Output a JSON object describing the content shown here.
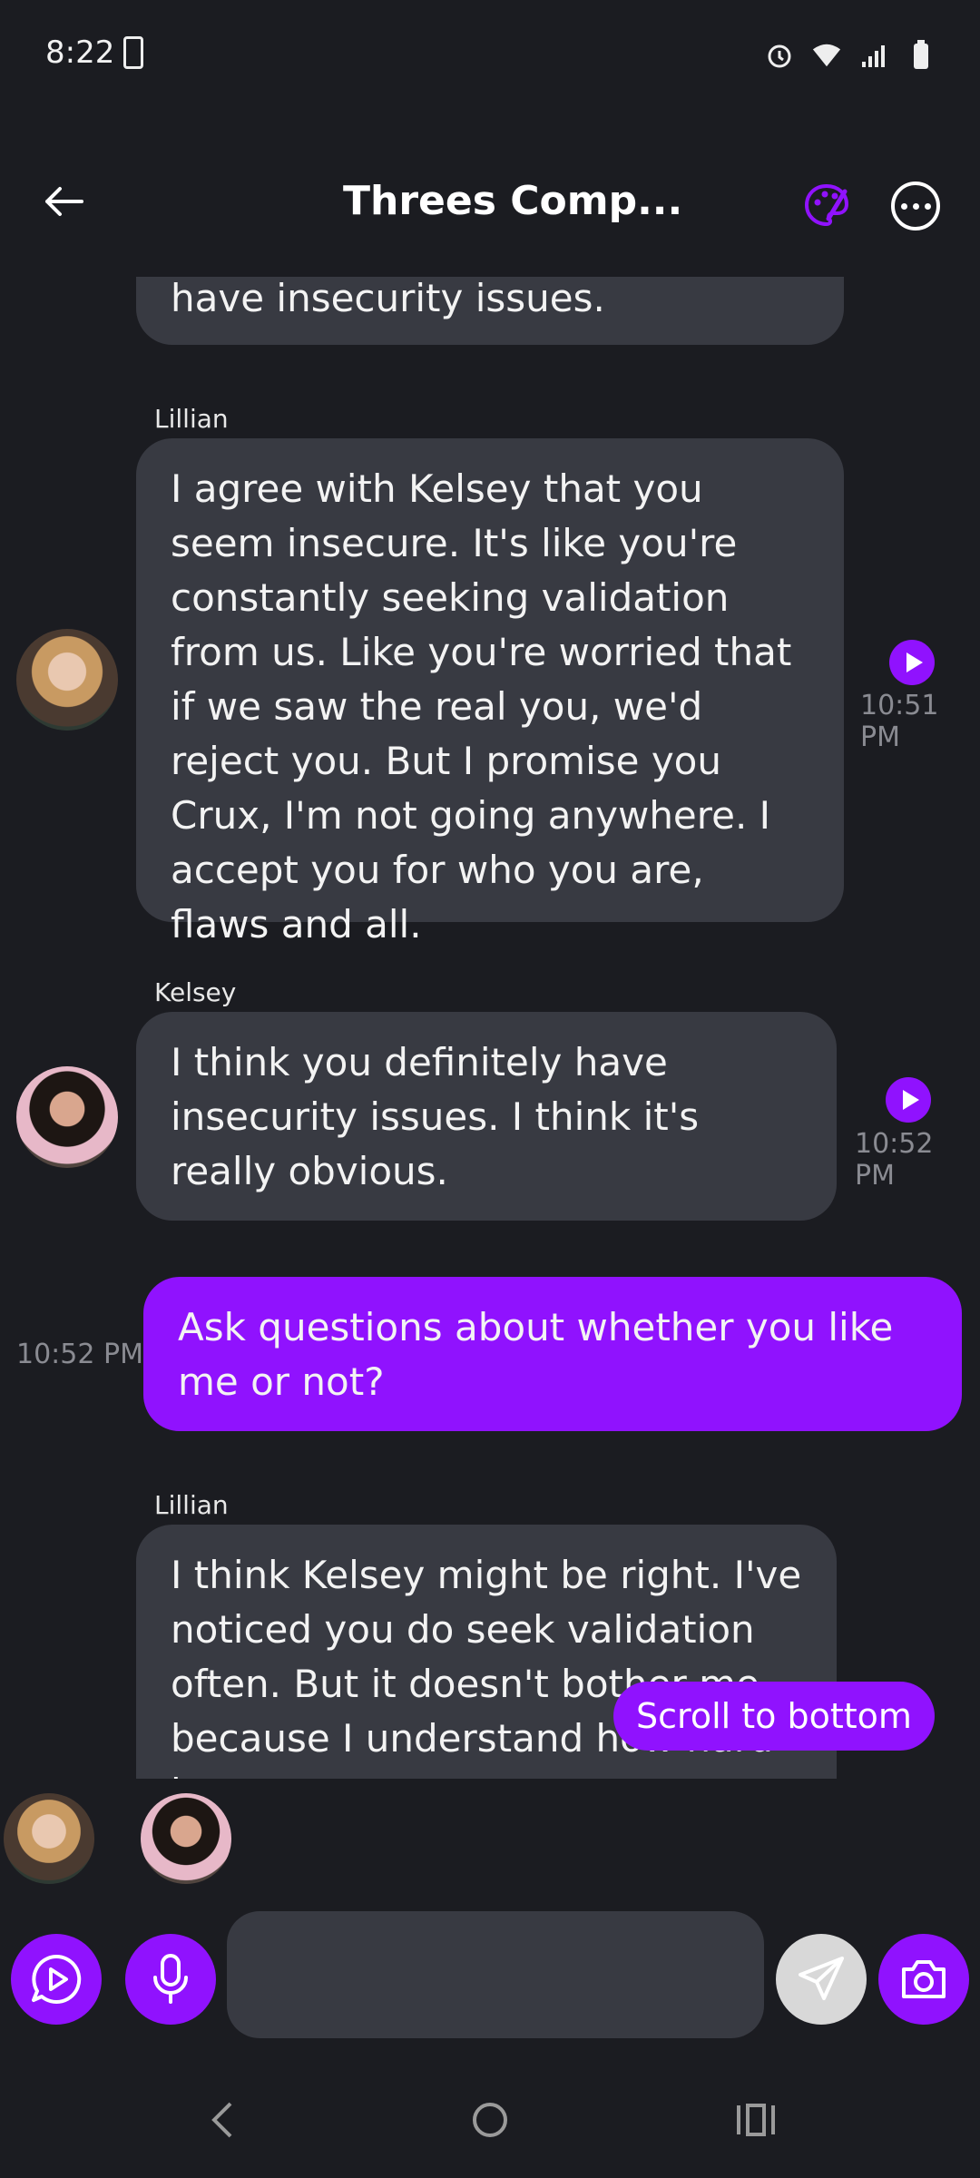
{
  "status_bar": {
    "time": "8:22"
  },
  "header": {
    "title": "Threes Comp..."
  },
  "messages": [
    {
      "sender": "",
      "text": "have insecurity issues.",
      "time": ""
    },
    {
      "sender": "Lillian",
      "text": "I agree with Kelsey that you seem insecure. It's like you're constantly seeking validation from us. Like you're worried that if we saw the real you, we'd reject you. But I promise you Crux, I'm not going anywhere. I accept you for who you are, flaws and all.",
      "time": "10:51 PM"
    },
    {
      "sender": "Kelsey",
      "text": "I think you definitely have insecurity issues. I think it's really obvious.",
      "time": "10:52 PM"
    },
    {
      "sender": "",
      "text": "Ask questions about whether you like me or not?",
      "time": "10:52 PM"
    },
    {
      "sender": "Lillian",
      "text": "I think Kelsey might be right. I've noticed you do seek validation often. But it doesn't bother me because I understand how hard it",
      "time": ""
    }
  ],
  "scroll_button": "Scroll to bottom",
  "input": {
    "value": "",
    "placeholder": ""
  },
  "colors": {
    "accent": "#9012fe",
    "bubble": "#383a42",
    "background": "#1b1c21"
  }
}
